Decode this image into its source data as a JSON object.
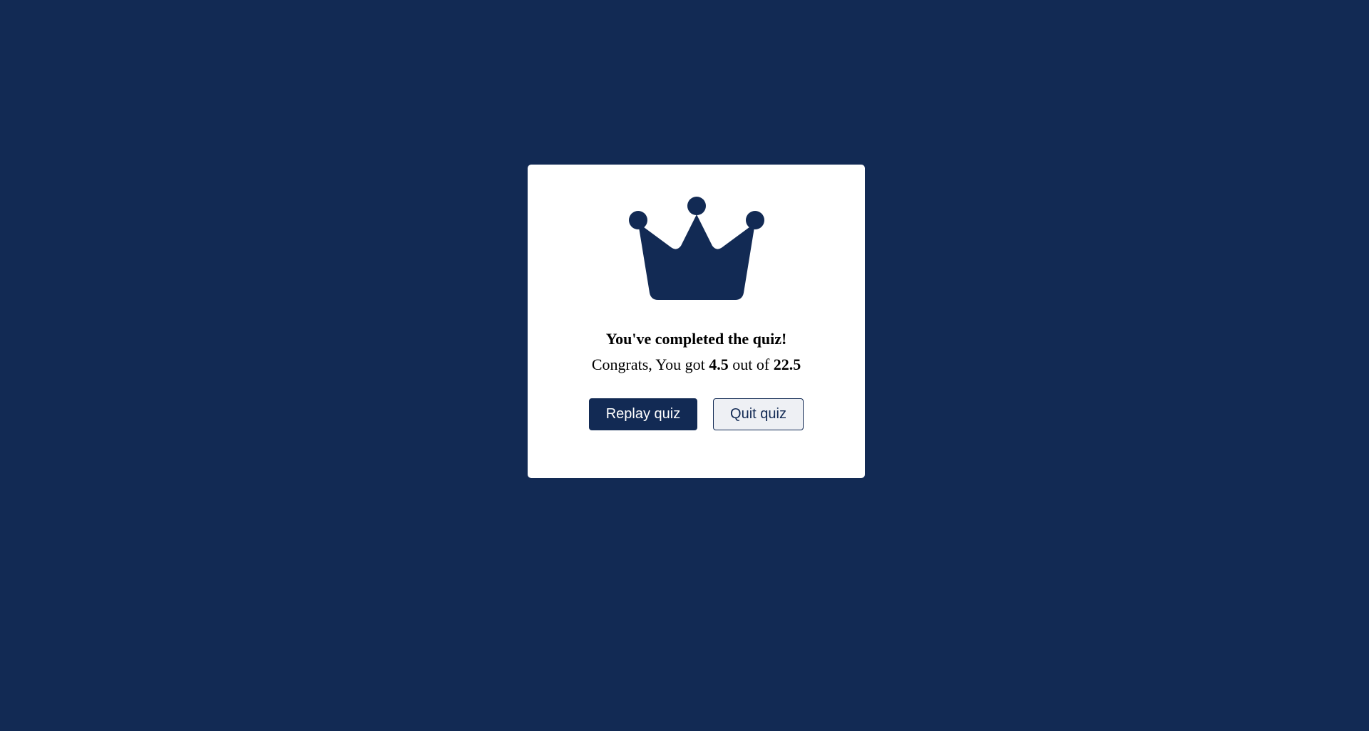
{
  "result": {
    "icon": "crown-icon",
    "title": "You've completed the quiz!",
    "score_prefix": "Congrats, You got",
    "score_value": "4.5",
    "score_middle": "out of",
    "score_total": "22.5"
  },
  "buttons": {
    "replay_label": "Replay quiz",
    "quit_label": "Quit quiz"
  },
  "colors": {
    "background": "#122a54",
    "card": "#ffffff",
    "accent": "#122a54"
  }
}
